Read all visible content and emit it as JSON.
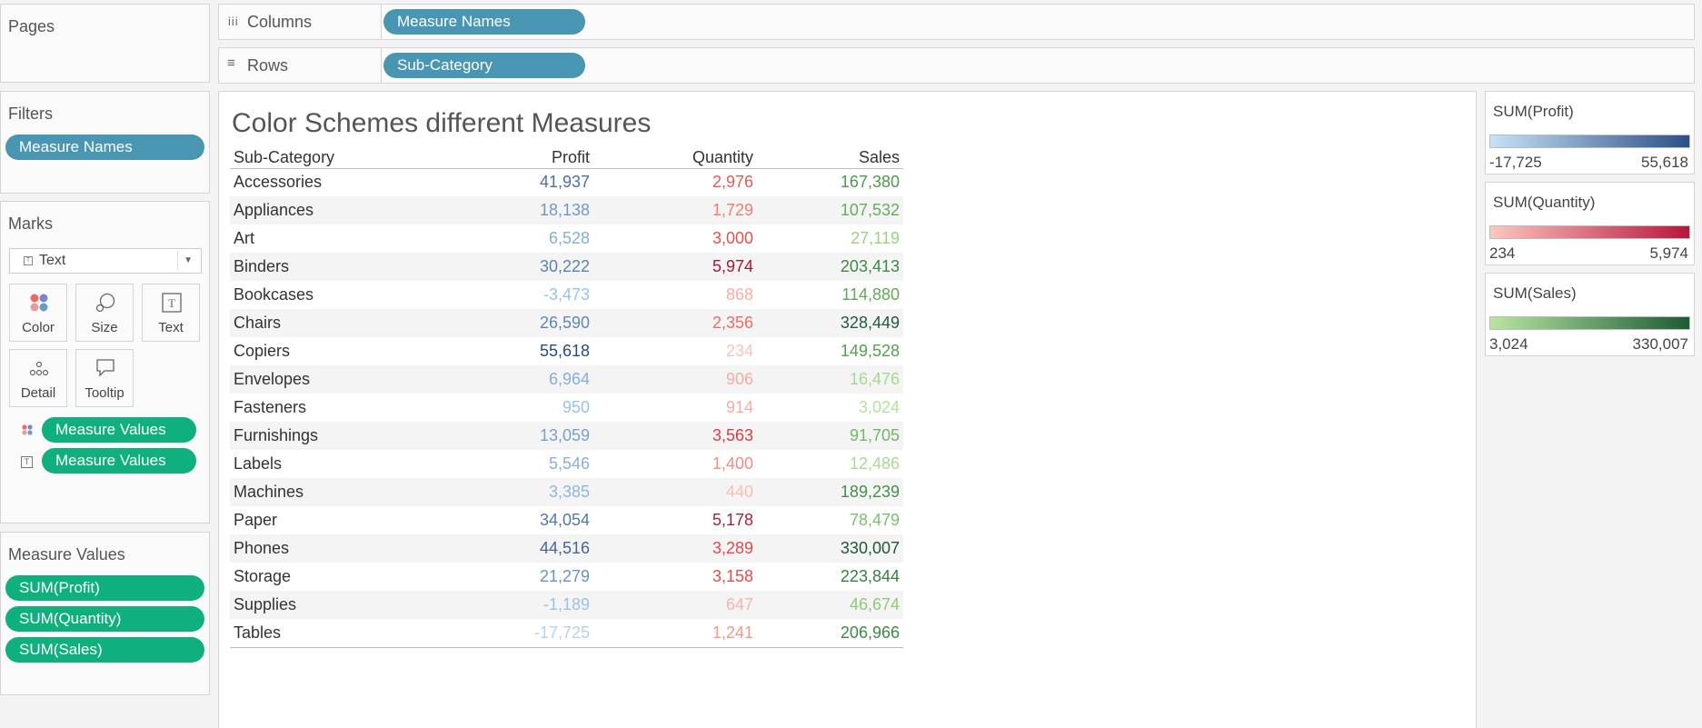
{
  "pages": {
    "title": "Pages"
  },
  "columns": {
    "label": "Columns",
    "icon": "columns-icon",
    "pill": "Measure Names"
  },
  "rows": {
    "label": "Rows",
    "icon": "rows-icon",
    "pill": "Sub-Category"
  },
  "filters": {
    "title": "Filters",
    "pill": "Measure Names"
  },
  "marks": {
    "title": "Marks",
    "type": "Text",
    "buttons": {
      "color": "Color",
      "size": "Size",
      "text": "Text",
      "detail": "Detail",
      "tooltip": "Tooltip"
    },
    "shelf": [
      {
        "icon": "color-dots-icon",
        "pill": "Measure Values"
      },
      {
        "icon": "text-icon",
        "pill": "Measure Values"
      }
    ]
  },
  "measure_values": {
    "title": "Measure Values",
    "pills": [
      "SUM(Profit)",
      "SUM(Quantity)",
      "SUM(Sales)"
    ]
  },
  "view": {
    "title": "Color Schemes different Measures",
    "headers": {
      "category": "Sub-Category",
      "profit": "Profit",
      "quantity": "Quantity",
      "sales": "Sales"
    },
    "rows": [
      {
        "category": "Accessories",
        "profit": "41,937",
        "quantity": "2,976",
        "sales": "167,380",
        "pc": "#4a6fa0",
        "qc": "#e05c55",
        "sc": "#4b9b4b"
      },
      {
        "category": "Appliances",
        "profit": "18,138",
        "quantity": "1,729",
        "sales": "107,532",
        "pc": "#6f9ac6",
        "qc": "#f07d72",
        "sc": "#62ae5a"
      },
      {
        "category": "Art",
        "profit": "6,528",
        "quantity": "3,000",
        "sales": "27,119",
        "pc": "#86addb",
        "qc": "#e0524f",
        "sc": "#97d27f"
      },
      {
        "category": "Binders",
        "profit": "30,222",
        "quantity": "5,974",
        "sales": "203,413",
        "pc": "#5883b2",
        "qc": "#a81636",
        "sc": "#3c8a44"
      },
      {
        "category": "Bookcases",
        "profit": "-3,473",
        "quantity": "868",
        "sales": "114,880",
        "pc": "#98c2e6",
        "qc": "#f7ada4",
        "sc": "#5eaa57"
      },
      {
        "category": "Chairs",
        "profit": "26,590",
        "quantity": "2,356",
        "sales": "328,449",
        "pc": "#5e87b5",
        "qc": "#eb6c65",
        "sc": "#1d5d37"
      },
      {
        "category": "Copiers",
        "profit": "55,618",
        "quantity": "234",
        "sales": "149,528",
        "pc": "#2a4a7f",
        "qc": "#fbc2bb",
        "sc": "#52a252"
      },
      {
        "category": "Envelopes",
        "profit": "6,964",
        "quantity": "906",
        "sales": "16,476",
        "pc": "#86addb",
        "qc": "#f7aba2",
        "sc": "#a5da8c"
      },
      {
        "category": "Fasteners",
        "profit": "950",
        "quantity": "914",
        "sales": "3,024",
        "pc": "#96c1e8",
        "qc": "#f7aba2",
        "sc": "#b2e39b"
      },
      {
        "category": "Furnishings",
        "profit": "13,059",
        "quantity": "3,563",
        "sales": "91,705",
        "pc": "#789fce",
        "qc": "#d83e47",
        "sc": "#6fb864"
      },
      {
        "category": "Labels",
        "profit": "5,546",
        "quantity": "1,400",
        "sales": "12,486",
        "pc": "#88aedb",
        "qc": "#f28c82",
        "sc": "#a7db8e"
      },
      {
        "category": "Machines",
        "profit": "3,385",
        "quantity": "440",
        "sales": "189,239",
        "pc": "#8fb5dc",
        "qc": "#fbbdb5",
        "sc": "#439147"
      },
      {
        "category": "Paper",
        "profit": "34,054",
        "quantity": "5,178",
        "sales": "78,479",
        "pc": "#5279aa",
        "qc": "#b01e39",
        "sc": "#7bbf6c"
      },
      {
        "category": "Phones",
        "profit": "44,516",
        "quantity": "3,289",
        "sales": "330,007",
        "pc": "#43659a",
        "qc": "#e04a4d",
        "sc": "#1b5a35"
      },
      {
        "category": "Storage",
        "profit": "21,279",
        "quantity": "3,158",
        "sales": "223,844",
        "pc": "#6a93c0",
        "qc": "#e04e4e",
        "sc": "#34803f"
      },
      {
        "category": "Supplies",
        "profit": "-1,189",
        "quantity": "647",
        "sales": "46,674",
        "pc": "#98c2e6",
        "qc": "#f9b3ab",
        "sc": "#8dca78"
      },
      {
        "category": "Tables",
        "profit": "-17,725",
        "quantity": "1,241",
        "sales": "206,966",
        "pc": "#b2d3ef",
        "qc": "#f3988d",
        "sc": "#3b8a43"
      }
    ]
  },
  "legends": [
    {
      "title": "SUM(Profit)",
      "min": "-17,725",
      "max": "55,618",
      "from": "#c7e2f6",
      "to": "#2c4f86"
    },
    {
      "title": "SUM(Quantity)",
      "min": "234",
      "max": "5,974",
      "from": "#fcc6bf",
      "to": "#b8163c"
    },
    {
      "title": "SUM(Sales)",
      "min": "3,024",
      "max": "330,007",
      "from": "#b8e6a0",
      "to": "#1c5c36"
    }
  ],
  "colors": {
    "blue_pill": "#4996b2",
    "green_pill": "#10b07e"
  }
}
